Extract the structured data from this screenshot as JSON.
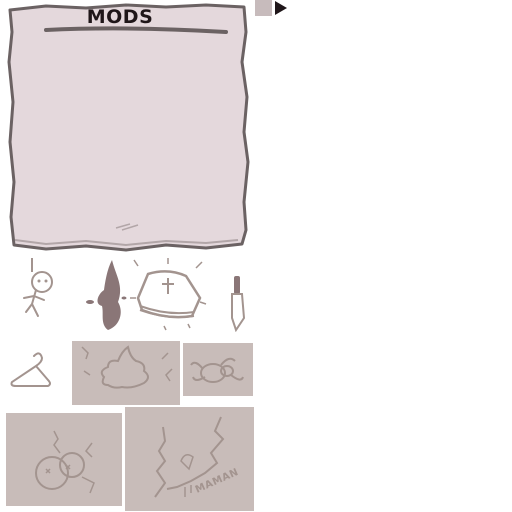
{
  "menu": {
    "title": "MODS"
  },
  "navigation": {
    "next_icon": "play-arrow-icon"
  },
  "sprites": {
    "hanged_figure": "hanged-figure-icon",
    "blood_splatter": "blood-splatter-icon",
    "stone_book": "stone-book-icon",
    "knife": "knife-icon",
    "coat_hanger": "coat-hanger-icon",
    "poop_sketch": "poop-icon",
    "spider_sketch": "spider-icon",
    "cracked_faces": "cracked-faces-icon",
    "maman_wall": "maman-wall-icon",
    "maman_label": "MAMAN"
  },
  "colors": {
    "paper": "#e4d8dc",
    "paper_edge": "#6b6263",
    "ink": "#1f1619",
    "tile": "#c8bcb9",
    "blood": "#8a7677",
    "sketch": "#a3948f"
  }
}
